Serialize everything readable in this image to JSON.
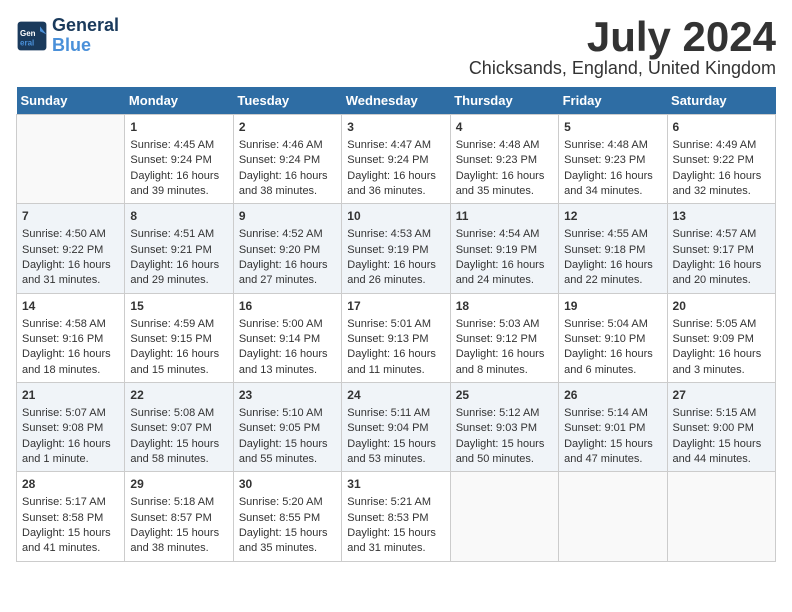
{
  "logo": {
    "line1": "General",
    "line2": "Blue"
  },
  "title": "July 2024",
  "location": "Chicksands, England, United Kingdom",
  "days_of_week": [
    "Sunday",
    "Monday",
    "Tuesday",
    "Wednesday",
    "Thursday",
    "Friday",
    "Saturday"
  ],
  "weeks": [
    [
      {
        "day": "",
        "empty": true
      },
      {
        "day": "1",
        "sunrise": "Sunrise: 4:45 AM",
        "sunset": "Sunset: 9:24 PM",
        "daylight": "Daylight: 16 hours and 39 minutes."
      },
      {
        "day": "2",
        "sunrise": "Sunrise: 4:46 AM",
        "sunset": "Sunset: 9:24 PM",
        "daylight": "Daylight: 16 hours and 38 minutes."
      },
      {
        "day": "3",
        "sunrise": "Sunrise: 4:47 AM",
        "sunset": "Sunset: 9:24 PM",
        "daylight": "Daylight: 16 hours and 36 minutes."
      },
      {
        "day": "4",
        "sunrise": "Sunrise: 4:48 AM",
        "sunset": "Sunset: 9:23 PM",
        "daylight": "Daylight: 16 hours and 35 minutes."
      },
      {
        "day": "5",
        "sunrise": "Sunrise: 4:48 AM",
        "sunset": "Sunset: 9:23 PM",
        "daylight": "Daylight: 16 hours and 34 minutes."
      },
      {
        "day": "6",
        "sunrise": "Sunrise: 4:49 AM",
        "sunset": "Sunset: 9:22 PM",
        "daylight": "Daylight: 16 hours and 32 minutes."
      }
    ],
    [
      {
        "day": "7",
        "sunrise": "Sunrise: 4:50 AM",
        "sunset": "Sunset: 9:22 PM",
        "daylight": "Daylight: 16 hours and 31 minutes."
      },
      {
        "day": "8",
        "sunrise": "Sunrise: 4:51 AM",
        "sunset": "Sunset: 9:21 PM",
        "daylight": "Daylight: 16 hours and 29 minutes."
      },
      {
        "day": "9",
        "sunrise": "Sunrise: 4:52 AM",
        "sunset": "Sunset: 9:20 PM",
        "daylight": "Daylight: 16 hours and 27 minutes."
      },
      {
        "day": "10",
        "sunrise": "Sunrise: 4:53 AM",
        "sunset": "Sunset: 9:19 PM",
        "daylight": "Daylight: 16 hours and 26 minutes."
      },
      {
        "day": "11",
        "sunrise": "Sunrise: 4:54 AM",
        "sunset": "Sunset: 9:19 PM",
        "daylight": "Daylight: 16 hours and 24 minutes."
      },
      {
        "day": "12",
        "sunrise": "Sunrise: 4:55 AM",
        "sunset": "Sunset: 9:18 PM",
        "daylight": "Daylight: 16 hours and 22 minutes."
      },
      {
        "day": "13",
        "sunrise": "Sunrise: 4:57 AM",
        "sunset": "Sunset: 9:17 PM",
        "daylight": "Daylight: 16 hours and 20 minutes."
      }
    ],
    [
      {
        "day": "14",
        "sunrise": "Sunrise: 4:58 AM",
        "sunset": "Sunset: 9:16 PM",
        "daylight": "Daylight: 16 hours and 18 minutes."
      },
      {
        "day": "15",
        "sunrise": "Sunrise: 4:59 AM",
        "sunset": "Sunset: 9:15 PM",
        "daylight": "Daylight: 16 hours and 15 minutes."
      },
      {
        "day": "16",
        "sunrise": "Sunrise: 5:00 AM",
        "sunset": "Sunset: 9:14 PM",
        "daylight": "Daylight: 16 hours and 13 minutes."
      },
      {
        "day": "17",
        "sunrise": "Sunrise: 5:01 AM",
        "sunset": "Sunset: 9:13 PM",
        "daylight": "Daylight: 16 hours and 11 minutes."
      },
      {
        "day": "18",
        "sunrise": "Sunrise: 5:03 AM",
        "sunset": "Sunset: 9:12 PM",
        "daylight": "Daylight: 16 hours and 8 minutes."
      },
      {
        "day": "19",
        "sunrise": "Sunrise: 5:04 AM",
        "sunset": "Sunset: 9:10 PM",
        "daylight": "Daylight: 16 hours and 6 minutes."
      },
      {
        "day": "20",
        "sunrise": "Sunrise: 5:05 AM",
        "sunset": "Sunset: 9:09 PM",
        "daylight": "Daylight: 16 hours and 3 minutes."
      }
    ],
    [
      {
        "day": "21",
        "sunrise": "Sunrise: 5:07 AM",
        "sunset": "Sunset: 9:08 PM",
        "daylight": "Daylight: 16 hours and 1 minute."
      },
      {
        "day": "22",
        "sunrise": "Sunrise: 5:08 AM",
        "sunset": "Sunset: 9:07 PM",
        "daylight": "Daylight: 15 hours and 58 minutes."
      },
      {
        "day": "23",
        "sunrise": "Sunrise: 5:10 AM",
        "sunset": "Sunset: 9:05 PM",
        "daylight": "Daylight: 15 hours and 55 minutes."
      },
      {
        "day": "24",
        "sunrise": "Sunrise: 5:11 AM",
        "sunset": "Sunset: 9:04 PM",
        "daylight": "Daylight: 15 hours and 53 minutes."
      },
      {
        "day": "25",
        "sunrise": "Sunrise: 5:12 AM",
        "sunset": "Sunset: 9:03 PM",
        "daylight": "Daylight: 15 hours and 50 minutes."
      },
      {
        "day": "26",
        "sunrise": "Sunrise: 5:14 AM",
        "sunset": "Sunset: 9:01 PM",
        "daylight": "Daylight: 15 hours and 47 minutes."
      },
      {
        "day": "27",
        "sunrise": "Sunrise: 5:15 AM",
        "sunset": "Sunset: 9:00 PM",
        "daylight": "Daylight: 15 hours and 44 minutes."
      }
    ],
    [
      {
        "day": "28",
        "sunrise": "Sunrise: 5:17 AM",
        "sunset": "Sunset: 8:58 PM",
        "daylight": "Daylight: 15 hours and 41 minutes."
      },
      {
        "day": "29",
        "sunrise": "Sunrise: 5:18 AM",
        "sunset": "Sunset: 8:57 PM",
        "daylight": "Daylight: 15 hours and 38 minutes."
      },
      {
        "day": "30",
        "sunrise": "Sunrise: 5:20 AM",
        "sunset": "Sunset: 8:55 PM",
        "daylight": "Daylight: 15 hours and 35 minutes."
      },
      {
        "day": "31",
        "sunrise": "Sunrise: 5:21 AM",
        "sunset": "Sunset: 8:53 PM",
        "daylight": "Daylight: 15 hours and 31 minutes."
      },
      {
        "day": "",
        "empty": true
      },
      {
        "day": "",
        "empty": true
      },
      {
        "day": "",
        "empty": true
      }
    ]
  ]
}
